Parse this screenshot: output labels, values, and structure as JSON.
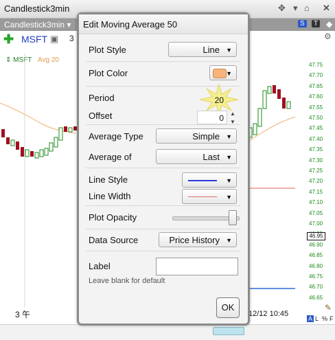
{
  "window": {
    "title": "Candlestick3min",
    "chart_tab": "Candlestick3min"
  },
  "symbol_bar": {
    "symbol": "MSFT",
    "quantity": "3"
  },
  "legend": {
    "symbol": "MSFT",
    "study": "Avg 20"
  },
  "price_axis": [
    "47.75",
    "47.70",
    "47.65",
    "47.60",
    "47.55",
    "47.50",
    "47.45",
    "47.40",
    "47.35",
    "47.30",
    "47.25",
    "47.20",
    "47.15",
    "47.10",
    "47.05",
    "47.00",
    "46.95",
    "46.90",
    "46.85",
    "46.80",
    "46.75",
    "46.70",
    "46.65"
  ],
  "current_price": "46.95",
  "time_axis": {
    "left": "3 午",
    "right": "12/12 10:45"
  },
  "toolbar_badges": {
    "s": "S",
    "t": "T"
  },
  "dialog": {
    "title": "Edit Moving Average 50",
    "plot_style_label": "Plot Style",
    "plot_style_value": "Line",
    "plot_color_label": "Plot Color",
    "plot_color_value": "#f8b37a",
    "period_label": "Period",
    "period_value": "20",
    "offset_label": "Offset",
    "offset_value": "0",
    "average_type_label": "Average Type",
    "average_type_value": "Simple",
    "average_of_label": "Average of",
    "average_of_value": "Last",
    "line_style_label": "Line Style",
    "line_style_color": "#2b3bd9",
    "line_width_label": "Line Width",
    "line_width_color": "#e07070",
    "plot_opacity_label": "Plot Opacity",
    "plot_opacity_value": 1.0,
    "data_source_label": "Data Source",
    "data_source_value": "Price History",
    "label_label": "Label",
    "label_value": "",
    "label_hint": "Leave blank for default",
    "ok_label": "OK"
  },
  "bottom_bar": {
    "a": "A",
    "l": "L",
    "pct": "%",
    "f": "F"
  }
}
